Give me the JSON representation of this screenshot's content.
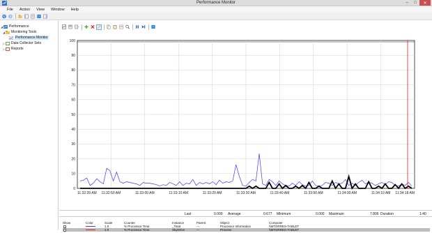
{
  "window": {
    "title": "Performance Monitor",
    "controls": {
      "minimize": "–",
      "maximize": "□",
      "close": "✕"
    }
  },
  "menubar": [
    "File",
    "Action",
    "View",
    "Window",
    "Help"
  ],
  "tree": [
    {
      "label": "Performance",
      "level": 0,
      "expanded": true,
      "icon": "performance-icon"
    },
    {
      "label": "Monitoring Tools",
      "level": 1,
      "expanded": true,
      "icon": "folder-icon"
    },
    {
      "label": "Performance Monitor",
      "level": 2,
      "selected": true,
      "icon": "chart-icon"
    },
    {
      "label": "Data Collector Sets",
      "level": 1,
      "expanded": false,
      "icon": "collector-icon"
    },
    {
      "label": "Reports",
      "level": 1,
      "expanded": false,
      "icon": "reports-icon"
    }
  ],
  "graph": {
    "y_ticks": [
      "100",
      "90",
      "80",
      "70",
      "60",
      "50",
      "40",
      "30",
      "20",
      "10",
      "0"
    ],
    "x_ticks": [
      "11:32:39 AM",
      "11:32:50 AM",
      "11:33:00 AM",
      "11:33:10 AM",
      "11:33:20 AM",
      "11:33:30 AM",
      "11:33:40 AM",
      "11:33:50 AM",
      "11:34:00 AM",
      "11:34:10 AM",
      "11:34:18 AM"
    ],
    "colors": {
      "total": "#3a3aff",
      "skydrive": "#000000",
      "cursor": "#e02020",
      "grid": "#d0d0d0"
    }
  },
  "chart_data": {
    "type": "line",
    "ylim": [
      0,
      100
    ],
    "series": [
      {
        "values": [
          5,
          5.5,
          7,
          2,
          3.5,
          6.5,
          4.5,
          3,
          13.5,
          12,
          5,
          11,
          4.5,
          3.5,
          4.5,
          4,
          3.5,
          3,
          2,
          4,
          3.5,
          3.5,
          3,
          2.5,
          1.5,
          2.5,
          2,
          4,
          3,
          2,
          4.5,
          2,
          3.5,
          3,
          6,
          2,
          4,
          3,
          4,
          3,
          4.5,
          2.5,
          5.5,
          3.5,
          4.5,
          4,
          5,
          16,
          8,
          2,
          1.5,
          4,
          6,
          5,
          23.5,
          3,
          2,
          6,
          4.5,
          2,
          5,
          3,
          2,
          1.5,
          3.5,
          2,
          4.5,
          2.5,
          1.5,
          2,
          5,
          2,
          1.5,
          2,
          4,
          3.5,
          2,
          4,
          3,
          3.5,
          6,
          2,
          3.5,
          2,
          4,
          5.5,
          3,
          4,
          3.5,
          2,
          3,
          4,
          2.5,
          4.5,
          4,
          2,
          1.5,
          3,
          2,
          4,
          1.5
        ]
      },
      {
        "values": [
          0,
          0,
          0,
          0,
          0,
          0,
          0,
          0,
          0,
          0,
          0,
          0,
          0,
          0,
          0,
          0,
          0,
          0,
          0,
          0,
          0,
          0,
          0,
          0,
          0,
          0,
          0,
          0,
          0,
          0,
          0,
          0,
          0,
          0,
          0,
          0,
          0,
          0,
          0,
          0,
          0,
          0,
          0,
          0,
          0,
          0,
          0,
          0,
          0,
          0,
          0,
          1.5,
          0,
          1.5,
          0,
          0,
          0,
          4,
          0,
          0,
          3,
          0,
          2,
          0,
          0,
          1.5,
          0,
          2,
          0,
          4,
          0,
          0,
          1.5,
          0,
          0,
          0,
          5,
          0,
          3,
          0,
          0,
          8,
          0,
          3,
          0,
          0,
          0,
          4.5,
          0,
          0,
          1.5,
          0,
          3,
          0,
          0,
          2.5,
          0,
          3,
          0,
          1.5,
          0
        ]
      }
    ]
  },
  "stats": {
    "last_label": "Last",
    "last_value": "0.000",
    "average_label": "Average",
    "average_value": "0.677",
    "minimum_label": "Minimum",
    "minimum_value": "0.000",
    "maximum_label": "Maximum",
    "maximum_value": "7.806",
    "duration_label": "Duration",
    "duration_value": "1:40"
  },
  "legend": {
    "headers": {
      "show": "Show",
      "color": "Color",
      "scale": "Scale",
      "counter": "Counter",
      "instance": "Instance",
      "parent": "Parent",
      "object": "Object",
      "computer": "Computer"
    },
    "rows": [
      {
        "check": "✓",
        "color": "#3a3aff",
        "scale": "1.0",
        "counter": "% Processor Time",
        "instance": "_Total",
        "parent": "---",
        "object": "Processor Information",
        "computer": "\\\\MTORRES-TABLET"
      },
      {
        "check": "✓",
        "color": "#e02020",
        "scale": "1.0",
        "counter": "% Processor Time",
        "instance": "SkyDrive",
        "parent": "---",
        "object": "Process",
        "computer": "\\\\MTORRES-TABLET"
      }
    ]
  }
}
